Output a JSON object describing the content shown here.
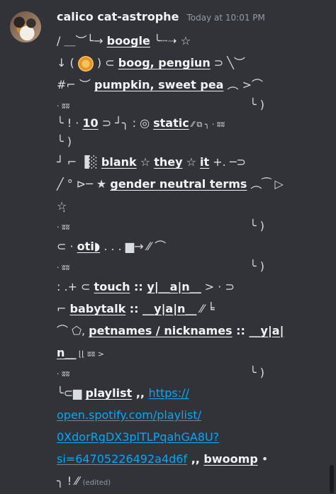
{
  "message": {
    "username": "calico cat-astrophe",
    "timestamp": "Today at 10:01 PM",
    "edited": "(edited)",
    "lines": {
      "l1": "/ ＿︶└→ ",
      "l1b": "boogle",
      "l1c": "  ╰┈➝ ☆",
      "l2a": "↓  (",
      "l2b": ") ⊂ ",
      "l2c": "boog, pengiun",
      "l2d": " ⊃ ╲︶",
      "l3a": "#⌐ ︶ ",
      "l3b": "pumpkin, sweet pea",
      "l3c": " ︵ >⌒",
      "l4a": "· ʬʬ",
      "l4b": "╰ )",
      "l5a": "╰ !  · ",
      "l5b": "10",
      "l5c": " ⊃ ┘╮  : ◎ ",
      "l5d": "static",
      "l5e": " ⁄⁄ ⧉ ╮ · ʬʬ",
      "l6a": "╰ )",
      "l7a": "┘ ⌐  ▐░  ",
      "l7b": "blank",
      "l7c": "  ☆  ",
      "l7d": "they",
      "l7e": "  ☆  ",
      "l7f": "it",
      "l7g": " +. ─⊃",
      "l8a": "╱ ° ⊳─ ★ ",
      "l8b": "gender neutral terms",
      "l8c": "  ︵⁀ ▷",
      "l9a": "☆̣",
      "l10a": "· ʬʬ",
      "l10b": "╰ )",
      "l11a": "⊂ · ",
      "l11b": "oti◗",
      "l11c": " . . .  ▆→  ⁄⁄ ⌒",
      "l12a": "· ʬʬ",
      "l12b": "╰ )",
      "l13a": " : .+ ⊂ ",
      "l13b": "touch",
      "l13c": " :: ",
      "l13d": "y|__a|n__",
      "l13e": "  > · ⊃",
      "l14a": "    ⌐  ",
      "l14b": "babytalk",
      "l14c": " :: ",
      "l14d": "__y|a|n__",
      "l14e": "  ⁄⁄ ╘",
      "l15a": "       ⌒ ⬠,  ",
      "l15b": "petnames / nicknames",
      "l15c": " :: ",
      "l15d": "__y|a|",
      "l16a": "n__",
      "l16b": "  ⌊⌊ ʬʬ >",
      "l17a": "· ʬʬ",
      "l17b": "╰ )",
      "l18a": "   ╰⊂▆   ",
      "l18b": "playlist",
      "l18c": "  ,, ",
      "l18d": "https://",
      "l19": "open.spotify.com/playlist/",
      "l20": "0XdorRgDX3plTLPqahGA8U?",
      "l21a": "si=64705226492a4d6f",
      "l21b": "  ,, ",
      "l21c": "bwoomp",
      "l21d": "  •",
      "l22a": "╮ !  ⁄⁄ "
    }
  }
}
